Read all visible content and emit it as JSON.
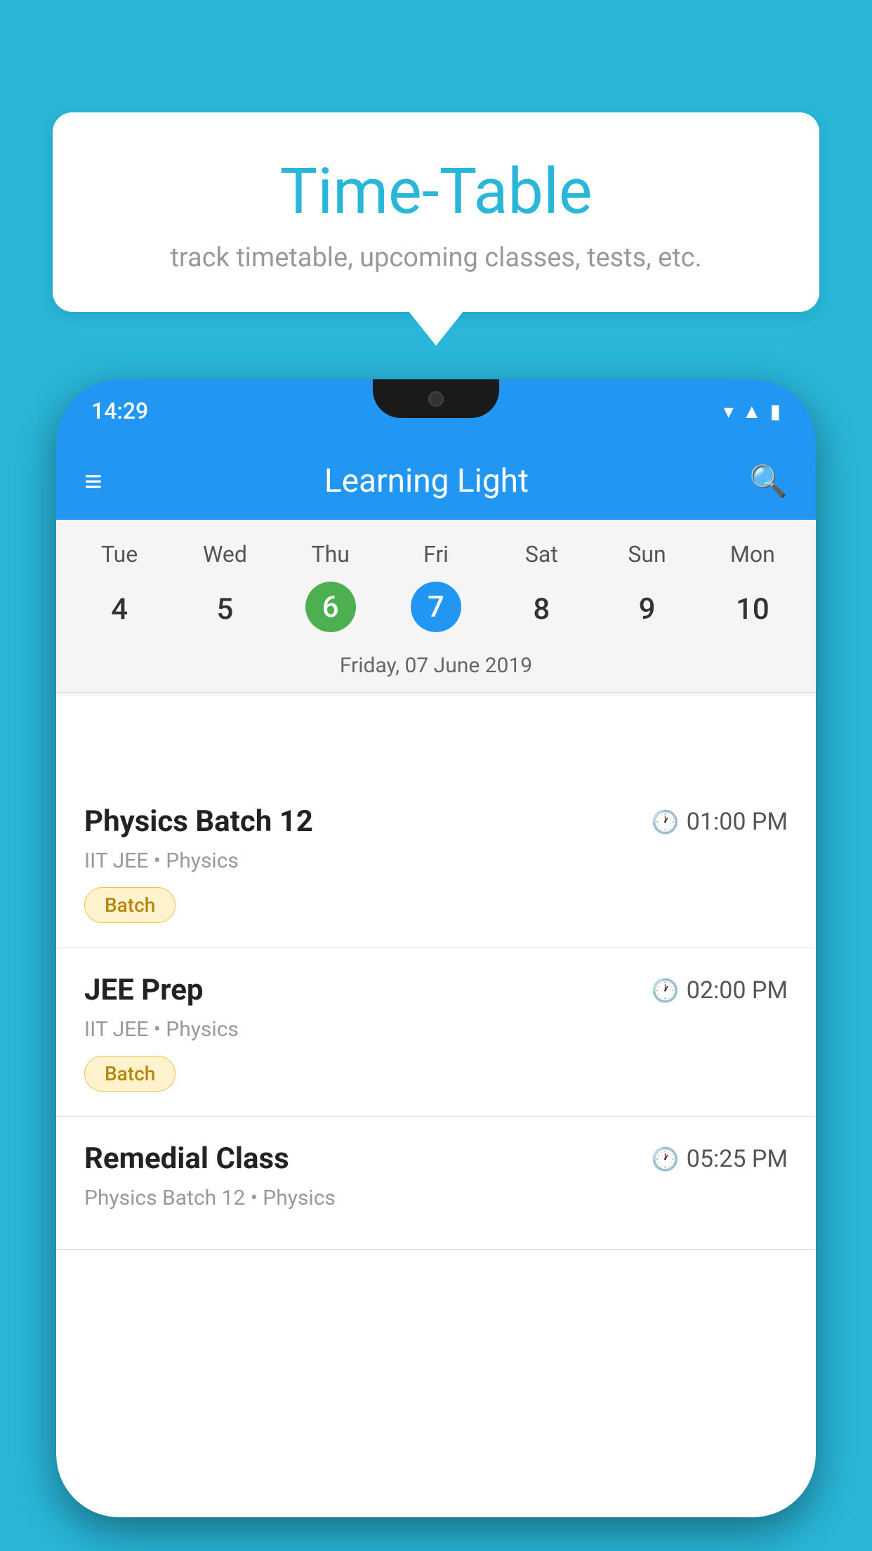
{
  "background_color": "#29B6D8",
  "tooltip": {
    "title": "Time-Table",
    "subtitle": "track timetable, upcoming classes, tests, etc."
  },
  "phone": {
    "status_bar": {
      "time": "14:29"
    },
    "app_bar": {
      "title": "Learning Light"
    },
    "calendar": {
      "day_headers": [
        "Tue",
        "Wed",
        "Thu",
        "Fri",
        "Sat",
        "Sun",
        "Mon"
      ],
      "day_numbers": [
        "4",
        "5",
        "6",
        "7",
        "8",
        "9",
        "10"
      ],
      "today_index": 2,
      "selected_index": 3,
      "selected_date_label": "Friday, 07 June 2019"
    },
    "schedule_items": [
      {
        "title": "Physics Batch 12",
        "time": "01:00 PM",
        "subtitle": "IIT JEE • Physics",
        "badge": "Batch"
      },
      {
        "title": "JEE Prep",
        "time": "02:00 PM",
        "subtitle": "IIT JEE • Physics",
        "badge": "Batch"
      },
      {
        "title": "Remedial Class",
        "time": "05:25 PM",
        "subtitle": "Physics Batch 12 • Physics",
        "badge": null
      }
    ]
  }
}
